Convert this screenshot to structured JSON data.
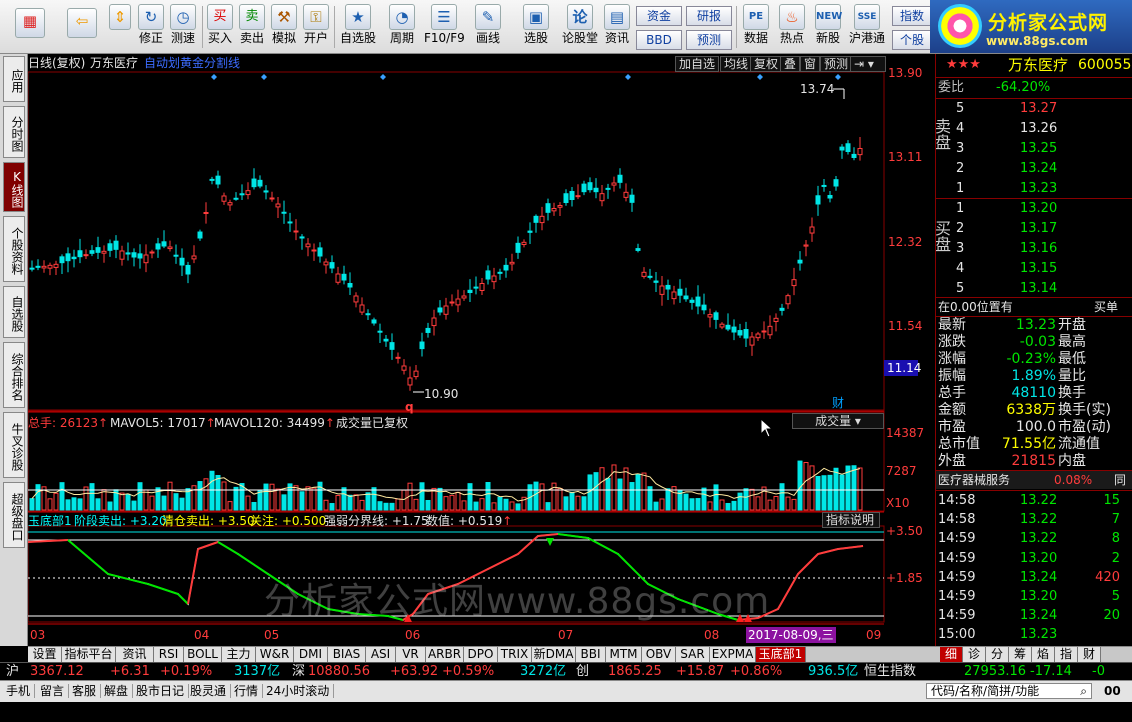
{
  "toolbar": {
    "buttons": [
      {
        "label": "",
        "icon": "grid-icon"
      },
      {
        "label": "",
        "icon": "back-arrow-icon"
      },
      {
        "label": "修正",
        "icon": "revise-icon"
      },
      {
        "label": "测速",
        "icon": "clock-icon"
      },
      {
        "label": "买入",
        "icon": "buy-icon"
      },
      {
        "label": "卖出",
        "icon": "sell-icon"
      },
      {
        "label": "模拟",
        "icon": "hammer-icon"
      },
      {
        "label": "开户",
        "icon": "lock-icon"
      },
      {
        "label": "自选股",
        "icon": "star-folder-icon"
      },
      {
        "label": "周期",
        "icon": "period-clock-icon"
      },
      {
        "label": "F10/F9",
        "icon": "f10-icon"
      },
      {
        "label": "画线",
        "icon": "pencil-icon"
      },
      {
        "label": "选股",
        "icon": "screen-icon"
      },
      {
        "label": "论股堂",
        "icon": "forum-icon"
      },
      {
        "label": "资讯",
        "icon": "news-icon"
      },
      {
        "label": "数据",
        "icon": "pe-icon"
      },
      {
        "label": "热点",
        "icon": "fire-icon"
      },
      {
        "label": "新股",
        "icon": "new-stock-icon"
      },
      {
        "label": "沪港通",
        "icon": "sse-hk-icon"
      }
    ],
    "pairs": [
      {
        "top": "资金",
        "bottom": "BBD"
      },
      {
        "top": "研报",
        "bottom": "预测"
      },
      {
        "top": "指数",
        "bottom": "个股"
      }
    ],
    "logo_text": "分析家公式网",
    "logo_url": "www.88gs.com"
  },
  "left_tabs": [
    {
      "label": "应用",
      "active": false
    },
    {
      "label": "分时图",
      "active": false
    },
    {
      "label": "K线图",
      "active": true
    },
    {
      "label": "个股资料",
      "active": false
    },
    {
      "label": "自选股",
      "active": false
    },
    {
      "label": "综合排名",
      "active": false
    },
    {
      "label": "牛叉诊股",
      "active": false
    },
    {
      "label": "超级盘口",
      "active": false
    }
  ],
  "chart_header": {
    "period": "日线(复权)",
    "stock_name": "万东医疗",
    "indicator_name": "自动划黄金分割线",
    "buttons": [
      "加自选",
      "均线",
      "复权",
      "叠",
      "窗",
      "预测"
    ]
  },
  "price_axis": {
    "labels": [
      "13.90",
      "13.11",
      "12.32",
      "11.54",
      "11.14"
    ],
    "current_marker": "11.14"
  },
  "annotations": {
    "high_label": "13.74",
    "low_label": "10.90",
    "q_marker": "q",
    "cai_marker": "财"
  },
  "volume_panel": {
    "label_total": "总手: 26123",
    "label_ma5": "MAVOL5: 17017",
    "label_ma120": "MAVOL120: 34499",
    "note": "成交量已复权",
    "selector": "成交量",
    "axis_labels": [
      "14387",
      "7287",
      "X10"
    ]
  },
  "indicator_panel": {
    "name": "玉底部1",
    "stage": "阶段卖出: +3.20",
    "clear": "清仓卖出: +3.50",
    "watch": "关注: +0.500",
    "bound": "强弱分界线: +1.75",
    "value": "数值: +0.519",
    "help_button": "指标说明",
    "axis_labels": [
      "+3.50",
      "+1.85"
    ]
  },
  "watermark": "分析家公式网www.88gs.com",
  "date_axis": {
    "labels": [
      "03",
      "04",
      "05",
      "06",
      "07",
      "08",
      "09"
    ],
    "cursor_date": "2017-08-09,三"
  },
  "bottom_tabs": [
    "设置",
    "指标平台",
    "资讯",
    "RSI",
    "BOLL",
    "主力",
    "W&R",
    "DMI",
    "BIAS",
    "ASI",
    "VR",
    "ARBR",
    "DPO",
    "TRIX",
    "新DMA",
    "BBI",
    "MTM",
    "OBV",
    "SAR",
    "EXPMA",
    "玉底部1"
  ],
  "right_bottom_tabs": [
    "细",
    "诊",
    "分",
    "筹",
    "焰",
    "指",
    "财"
  ],
  "right_panel": {
    "stars": "★★★",
    "name": "万东医疗",
    "code": "600055",
    "weibi_label": "委比",
    "weibi_value": "-64.20%",
    "sell_label": "卖盘",
    "buy_label": "买盘",
    "sell": [
      {
        "level": "5",
        "price": "13.27"
      },
      {
        "level": "4",
        "price": "13.26"
      },
      {
        "level": "3",
        "price": "13.25"
      },
      {
        "level": "2",
        "price": "13.24"
      },
      {
        "level": "1",
        "price": "13.23"
      }
    ],
    "buy": [
      {
        "level": "1",
        "price": "13.20"
      },
      {
        "level": "2",
        "price": "13.17"
      },
      {
        "level": "3",
        "price": "13.16"
      },
      {
        "level": "4",
        "price": "13.15"
      },
      {
        "level": "5",
        "price": "13.14"
      }
    ],
    "position_text": "在0.00位置有",
    "position_right": "买单",
    "stats": [
      {
        "label": "最新",
        "value": "13.23",
        "right": "开盘"
      },
      {
        "label": "涨跌",
        "value": "-0.03",
        "right": "最高"
      },
      {
        "label": "涨幅",
        "value": "-0.23%",
        "right": "最低"
      },
      {
        "label": "振幅",
        "value": "1.89%",
        "right": "量比"
      },
      {
        "label": "总手",
        "value": "48110",
        "right": "换手"
      },
      {
        "label": "金额",
        "value": "6338万",
        "right": "换手(实)"
      },
      {
        "label": "市盈",
        "value": "100.0",
        "right": "市盈(动)"
      },
      {
        "label": "总市值",
        "value": "71.55亿",
        "right": "流通值"
      },
      {
        "label": "外盘",
        "value": "21815",
        "right": "内盘"
      }
    ],
    "sector_name": "医疗器械服务",
    "sector_change": "0.08%",
    "sector_right": "同",
    "ticks": [
      {
        "time": "14:58",
        "price": "13.22",
        "vol": "15"
      },
      {
        "time": "14:58",
        "price": "13.22",
        "vol": "7"
      },
      {
        "time": "14:59",
        "price": "13.22",
        "vol": "8"
      },
      {
        "time": "14:59",
        "price": "13.20",
        "vol": "2"
      },
      {
        "time": "14:59",
        "price": "13.24",
        "vol": "420"
      },
      {
        "time": "14:59",
        "price": "13.20",
        "vol": "5"
      },
      {
        "time": "14:59",
        "price": "13.24",
        "vol": "20"
      },
      {
        "time": "15:00",
        "price": "13.23",
        "vol": ""
      }
    ]
  },
  "status": {
    "sh_label": "沪",
    "sh_index": "3367.12",
    "sh_change": "+6.31",
    "sh_pct": "+0.19%",
    "sh_amount": "3137亿",
    "sz_label": "深",
    "sz_index": "10880.56",
    "sz_change": "+63.92",
    "sz_pct": "+0.59%",
    "sz_amount": "3272亿",
    "cy_label": "创",
    "cy_index": "1865.25",
    "cy_change": "+15.87",
    "cy_pct": "+0.86%",
    "cy_amount": "936.5亿",
    "hs_label": "恒生指数",
    "hs_index": "27953.16",
    "hs_change": "-17.14",
    "hs_extra": "-0"
  },
  "status2": {
    "items": [
      "手机",
      "留言",
      "客服",
      "解盘",
      "股市日记",
      "股灵通",
      "行情",
      "24小时滚动"
    ],
    "code_placeholder": "代码/名称/简拼/功能",
    "right_text": "00"
  },
  "colors": {
    "up": "#ff3c3c",
    "down": "#00e6e6",
    "yellow": "#ffff00",
    "green": "#00e600"
  }
}
